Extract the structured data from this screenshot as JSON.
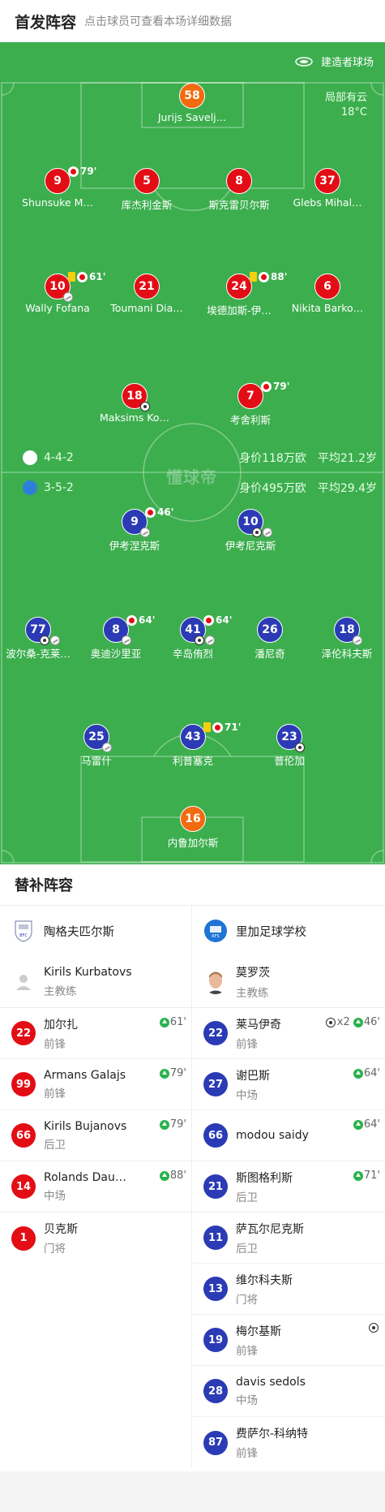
{
  "header": {
    "title": "首发阵容",
    "subtitle": "点击球员可查看本场详细数据"
  },
  "pitch": {
    "stadium": "建造者球场",
    "weather": "局部有云",
    "temperature": "18°C",
    "watermark": "懂球帝"
  },
  "home": {
    "formation": "4-4-2",
    "value": "身价118万欧",
    "age": "平均21.2岁",
    "color": "#e30d16",
    "goalkeeper": {
      "number": "58",
      "name": "Jurijs Savelj…"
    },
    "defenders": [
      {
        "number": "9",
        "name": "Shunsuke M…",
        "sub": "79'"
      },
      {
        "number": "5",
        "name": "库杰利金斯"
      },
      {
        "number": "8",
        "name": "斯克雷贝尔斯"
      },
      {
        "number": "37",
        "name": "Glebs Mihal…"
      }
    ],
    "midfielders": [
      {
        "number": "10",
        "name": "Wally Fofana",
        "sub": "61'"
      },
      {
        "number": "21",
        "name": "Toumani Dia…"
      },
      {
        "number": "24",
        "name": "埃德加斯-伊…",
        "sub": "88'"
      },
      {
        "number": "6",
        "name": "Nikita Barko…"
      }
    ],
    "forwards": [
      {
        "number": "18",
        "name": "Maksims Ko…"
      },
      {
        "number": "7",
        "name": "考舍利斯",
        "sub": "79'"
      }
    ]
  },
  "away": {
    "formation": "3-5-2",
    "value": "身价495万欧",
    "age": "平均29.4岁",
    "color": "#2b3bb5",
    "forwards": [
      {
        "number": "9",
        "name": "伊考涅克斯",
        "sub": "46'"
      },
      {
        "number": "10",
        "name": "伊考尼克斯"
      }
    ],
    "midfielders": [
      {
        "number": "77",
        "name": "波尔桑-克莱…"
      },
      {
        "number": "8",
        "name": "奥迪沙里亚",
        "sub": "64'"
      },
      {
        "number": "41",
        "name": "辛岛侑烈",
        "sub": "64'"
      },
      {
        "number": "26",
        "name": "潘尼奇"
      },
      {
        "number": "18",
        "name": "泽伦科夫斯"
      }
    ],
    "defenders": [
      {
        "number": "25",
        "name": "马雷什"
      },
      {
        "number": "43",
        "name": "利普塞克",
        "sub": "71'"
      },
      {
        "number": "23",
        "name": "普伦加"
      }
    ],
    "goalkeeper": {
      "number": "16",
      "name": "内鲁加尔斯"
    }
  },
  "subs": {
    "title": "替补阵容",
    "left": {
      "team": "陶格夫匹尔斯",
      "coach": {
        "name": "Kirils Kurbatovs",
        "role": "主教练"
      },
      "players": [
        {
          "number": "22",
          "name": "加尔扎",
          "pos": "前锋",
          "event": "61'"
        },
        {
          "number": "99",
          "name": "Armans Galajs",
          "pos": "前锋",
          "event": "79'"
        },
        {
          "number": "66",
          "name": "Kirils Bujanovs",
          "pos": "后卫",
          "event": "79'"
        },
        {
          "number": "14",
          "name": "Rolands Dau…",
          "pos": "中场",
          "event": "88'"
        },
        {
          "number": "1",
          "name": "贝克斯",
          "pos": "门将"
        }
      ]
    },
    "right": {
      "team": "里加足球学校",
      "coach": {
        "name": "莫罗茨",
        "role": "主教练"
      },
      "players": [
        {
          "number": "22",
          "name": "莱马伊奇",
          "pos": "前锋",
          "goals": "x2",
          "event": "46'"
        },
        {
          "number": "27",
          "name": "谢巴斯",
          "pos": "中场",
          "event": "64'"
        },
        {
          "number": "66",
          "name": "modou saidy",
          "pos": "",
          "event": "64'"
        },
        {
          "number": "21",
          "name": "斯图格利斯",
          "pos": "后卫",
          "event": "71'"
        },
        {
          "number": "11",
          "name": "萨瓦尔尼克斯",
          "pos": "后卫"
        },
        {
          "number": "13",
          "name": "维尔科夫斯",
          "pos": "门将"
        },
        {
          "number": "19",
          "name": "梅尔基斯",
          "pos": "前锋"
        },
        {
          "number": "28",
          "name": "davis sedols",
          "pos": "中场"
        },
        {
          "number": "87",
          "name": "费萨尔-科纳特",
          "pos": "前锋"
        }
      ]
    }
  }
}
